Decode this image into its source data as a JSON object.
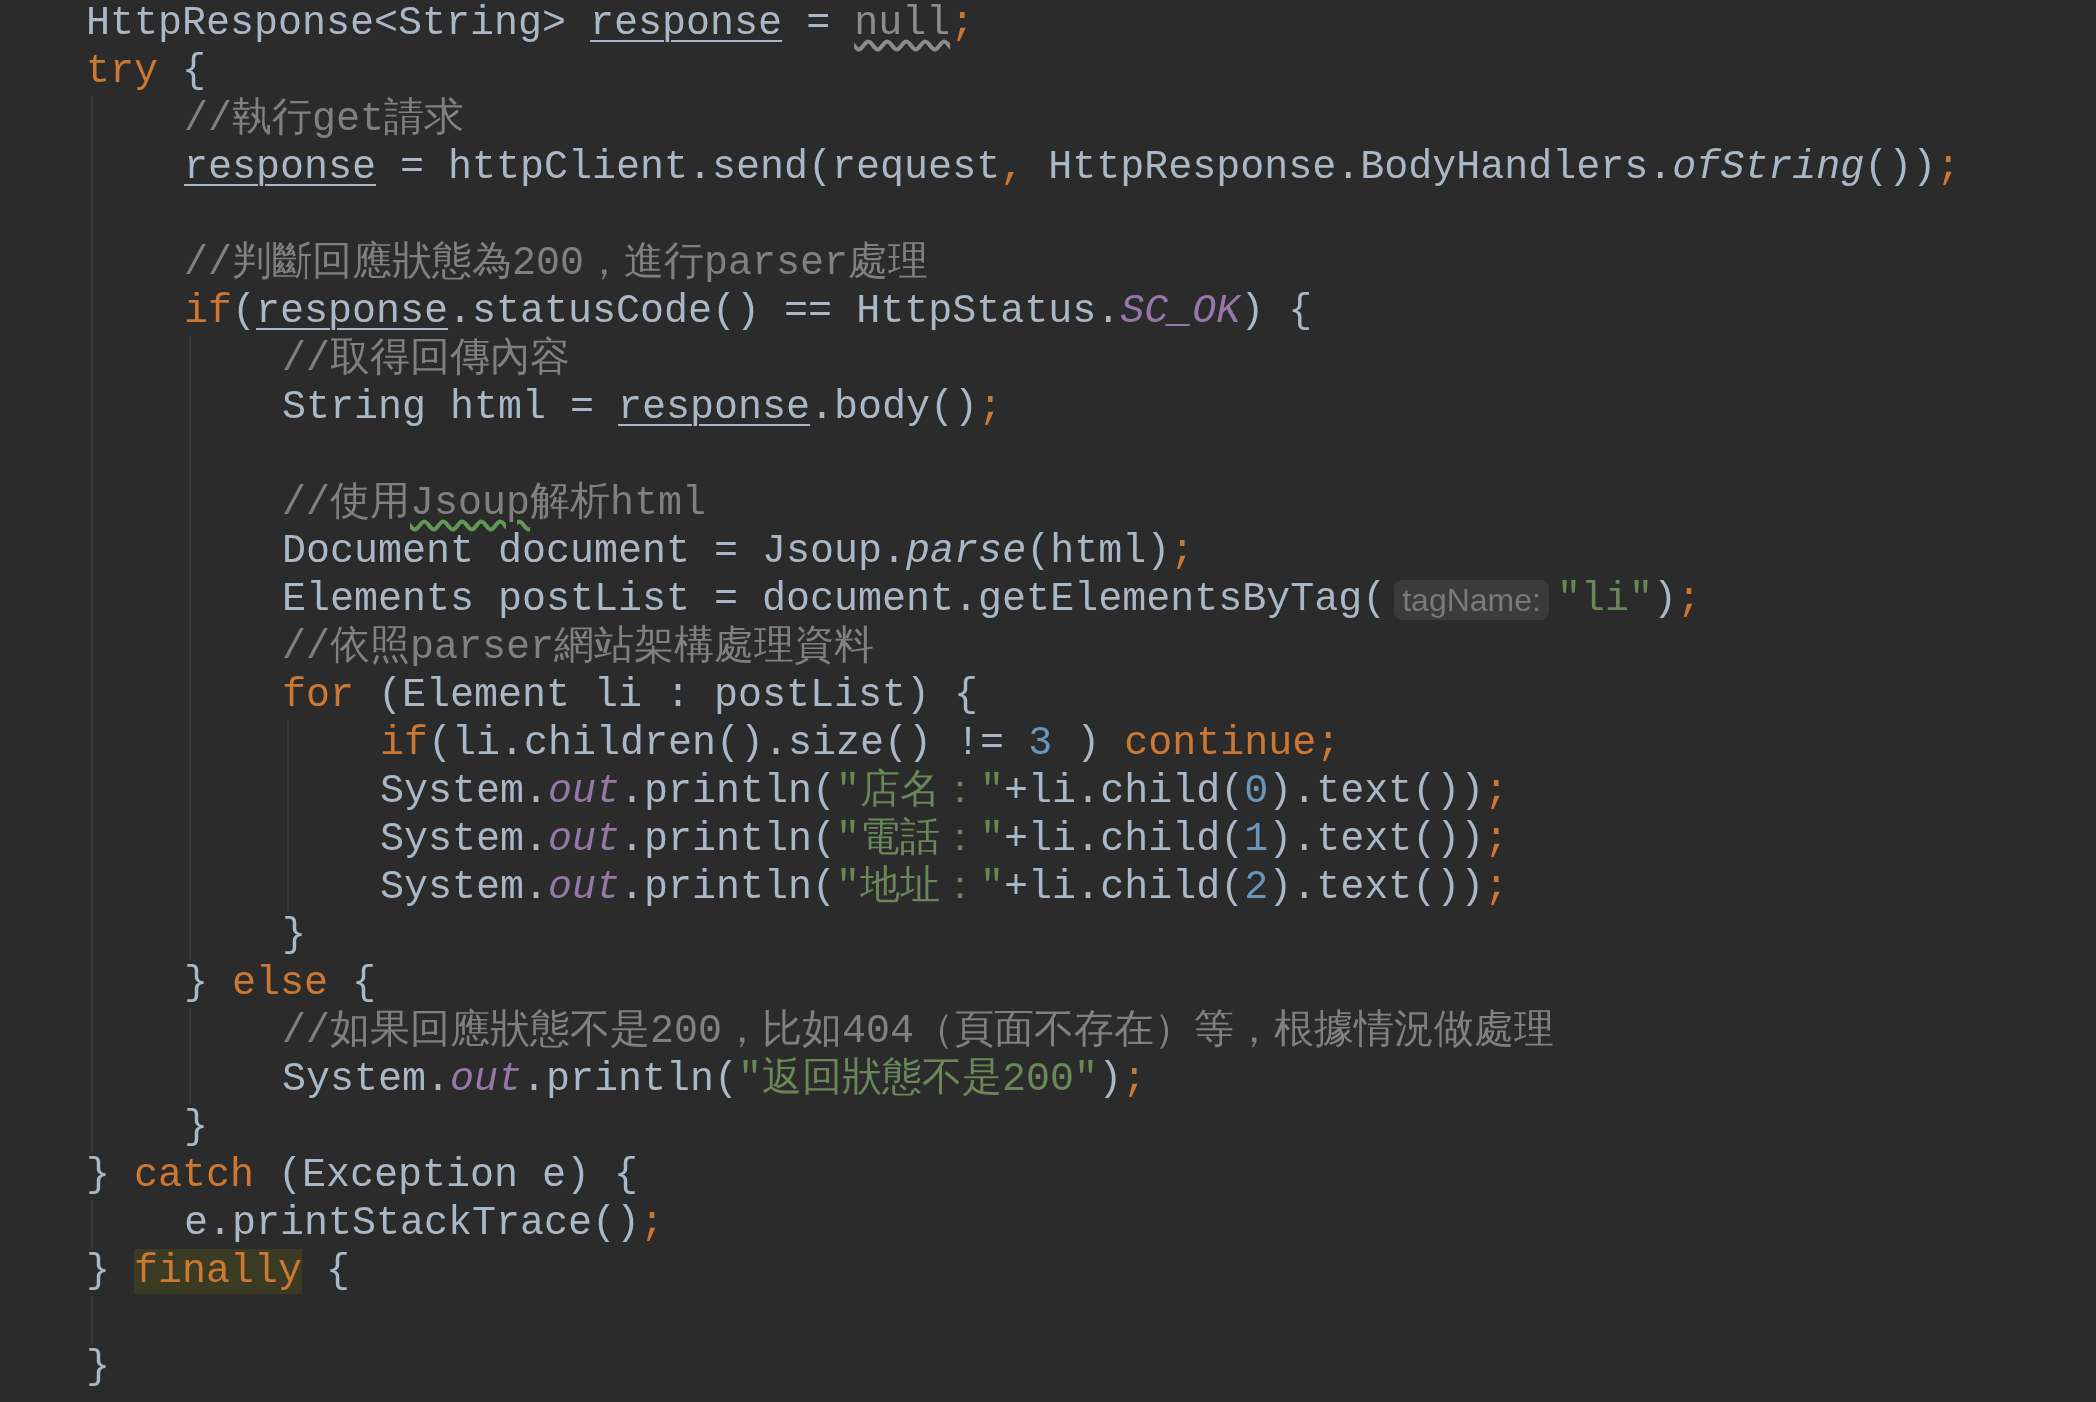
{
  "editor": {
    "lines": [
      {
        "kind": "code",
        "tokens": [
          {
            "kind": "plain",
            "text": "HttpResponse<String> "
          },
          {
            "kind": "var",
            "text": "response"
          },
          {
            "kind": "plain",
            "text": " = "
          },
          {
            "kind": "warning",
            "text": "null"
          },
          {
            "kind": "punct",
            "text": ";"
          }
        ]
      },
      {
        "kind": "code",
        "tokens": [
          {
            "kind": "keyword",
            "text": "try"
          },
          {
            "kind": "plain",
            "text": " {"
          }
        ],
        "children": [
          {
            "kind": "code",
            "tokens": [
              {
                "kind": "comment",
                "text": "//執行get請求"
              }
            ]
          },
          {
            "kind": "code",
            "tokens": [
              {
                "kind": "var",
                "text": "response"
              },
              {
                "kind": "plain",
                "text": " = httpClient.send(request"
              },
              {
                "kind": "punct",
                "text": ","
              },
              {
                "kind": "plain",
                "text": " HttpResponse.BodyHandlers."
              },
              {
                "kind": "italic",
                "text": "ofString"
              },
              {
                "kind": "plain",
                "text": "())"
              },
              {
                "kind": "punct",
                "text": ";"
              }
            ]
          },
          {
            "kind": "blank"
          },
          {
            "kind": "code",
            "tokens": [
              {
                "kind": "comment",
                "text": "//判斷回應狀態為200，進行parser處理"
              }
            ]
          },
          {
            "kind": "code",
            "tokens": [
              {
                "kind": "keyword",
                "text": "if"
              },
              {
                "kind": "plain",
                "text": "("
              },
              {
                "kind": "var",
                "text": "response"
              },
              {
                "kind": "plain",
                "text": ".statusCode() == HttpStatus."
              },
              {
                "kind": "field",
                "text": "SC_OK"
              },
              {
                "kind": "plain",
                "text": ") {"
              }
            ],
            "children": [
              {
                "kind": "code",
                "tokens": [
                  {
                    "kind": "comment",
                    "text": "//取得回傳內容"
                  }
                ]
              },
              {
                "kind": "code",
                "tokens": [
                  {
                    "kind": "plain",
                    "text": "String html = "
                  },
                  {
                    "kind": "var",
                    "text": "response"
                  },
                  {
                    "kind": "plain",
                    "text": ".body()"
                  },
                  {
                    "kind": "punct",
                    "text": ";"
                  }
                ]
              },
              {
                "kind": "blank"
              },
              {
                "kind": "code",
                "tokens": [
                  {
                    "kind": "comment",
                    "text": "//使用"
                  },
                  {
                    "kind": "typo",
                    "text": "Jsoup"
                  },
                  {
                    "kind": "comment",
                    "text": "解析html"
                  }
                ]
              },
              {
                "kind": "code",
                "tokens": [
                  {
                    "kind": "plain",
                    "text": "Document document = Jsoup."
                  },
                  {
                    "kind": "italic",
                    "text": "parse"
                  },
                  {
                    "kind": "plain",
                    "text": "(html)"
                  },
                  {
                    "kind": "punct",
                    "text": ";"
                  }
                ]
              },
              {
                "kind": "code",
                "tokens": [
                  {
                    "kind": "plain",
                    "text": "Elements postList = document.getElementsByTag("
                  },
                  {
                    "kind": "hint",
                    "text": "tagName:"
                  },
                  {
                    "kind": "string",
                    "text": "\"li\""
                  },
                  {
                    "kind": "plain",
                    "text": ")"
                  },
                  {
                    "kind": "punct",
                    "text": ";"
                  }
                ]
              },
              {
                "kind": "code",
                "tokens": [
                  {
                    "kind": "comment",
                    "text": "//依照parser網站架構處理資料"
                  }
                ]
              },
              {
                "kind": "code",
                "tokens": [
                  {
                    "kind": "keyword",
                    "text": "for"
                  },
                  {
                    "kind": "plain",
                    "text": " (Element li : postList) {"
                  }
                ],
                "children": [
                  {
                    "kind": "code",
                    "tokens": [
                      {
                        "kind": "keyword",
                        "text": "if"
                      },
                      {
                        "kind": "plain",
                        "text": "(li.children().size() != "
                      },
                      {
                        "kind": "number",
                        "text": "3"
                      },
                      {
                        "kind": "plain",
                        "text": " ) "
                      },
                      {
                        "kind": "keyword",
                        "text": "continue"
                      },
                      {
                        "kind": "punct",
                        "text": ";"
                      }
                    ]
                  },
                  {
                    "kind": "code",
                    "tokens": [
                      {
                        "kind": "plain",
                        "text": "System."
                      },
                      {
                        "kind": "field",
                        "text": "out"
                      },
                      {
                        "kind": "plain",
                        "text": ".println("
                      },
                      {
                        "kind": "string",
                        "text": "\"店名：\""
                      },
                      {
                        "kind": "plain",
                        "text": "+li.child("
                      },
                      {
                        "kind": "number",
                        "text": "0"
                      },
                      {
                        "kind": "plain",
                        "text": ").text())"
                      },
                      {
                        "kind": "punct",
                        "text": ";"
                      }
                    ]
                  },
                  {
                    "kind": "code",
                    "tokens": [
                      {
                        "kind": "plain",
                        "text": "System."
                      },
                      {
                        "kind": "field",
                        "text": "out"
                      },
                      {
                        "kind": "plain",
                        "text": ".println("
                      },
                      {
                        "kind": "string",
                        "text": "\"電話：\""
                      },
                      {
                        "kind": "plain",
                        "text": "+li.child("
                      },
                      {
                        "kind": "number",
                        "text": "1"
                      },
                      {
                        "kind": "plain",
                        "text": ").text())"
                      },
                      {
                        "kind": "punct",
                        "text": ";"
                      }
                    ]
                  },
                  {
                    "kind": "code",
                    "tokens": [
                      {
                        "kind": "plain",
                        "text": "System."
                      },
                      {
                        "kind": "field",
                        "text": "out"
                      },
                      {
                        "kind": "plain",
                        "text": ".println("
                      },
                      {
                        "kind": "string",
                        "text": "\"地址：\""
                      },
                      {
                        "kind": "plain",
                        "text": "+li.child("
                      },
                      {
                        "kind": "number",
                        "text": "2"
                      },
                      {
                        "kind": "plain",
                        "text": ").text())"
                      },
                      {
                        "kind": "punct",
                        "text": ";"
                      }
                    ]
                  }
                ]
              },
              {
                "kind": "code",
                "tokens": [
                  {
                    "kind": "plain",
                    "text": "}"
                  }
                ]
              }
            ]
          },
          {
            "kind": "code",
            "tokens": [
              {
                "kind": "plain",
                "text": "} "
              },
              {
                "kind": "keyword",
                "text": "else"
              },
              {
                "kind": "plain",
                "text": " {"
              }
            ],
            "children": [
              {
                "kind": "code",
                "tokens": [
                  {
                    "kind": "comment",
                    "text": "//如果回應狀態不是200，比如404（頁面不存在）等，根據情況做處理"
                  }
                ]
              },
              {
                "kind": "code",
                "tokens": [
                  {
                    "kind": "plain",
                    "text": "System."
                  },
                  {
                    "kind": "field",
                    "text": "out"
                  },
                  {
                    "kind": "plain",
                    "text": ".println("
                  },
                  {
                    "kind": "string",
                    "text": "\"返回狀態不是200\""
                  },
                  {
                    "kind": "plain",
                    "text": ")"
                  },
                  {
                    "kind": "punct",
                    "text": ";"
                  }
                ]
              }
            ]
          },
          {
            "kind": "code",
            "tokens": [
              {
                "kind": "plain",
                "text": "}"
              }
            ]
          }
        ]
      },
      {
        "kind": "code",
        "tokens": [
          {
            "kind": "plain",
            "text": "} "
          },
          {
            "kind": "keyword",
            "text": "catch"
          },
          {
            "kind": "plain",
            "text": " (Exception e) {"
          }
        ],
        "children": [
          {
            "kind": "code",
            "tokens": [
              {
                "kind": "plain",
                "text": "e.printStackTrace()"
              },
              {
                "kind": "punct",
                "text": ";"
              }
            ]
          }
        ]
      },
      {
        "kind": "code",
        "tokens": [
          {
            "kind": "plain",
            "text": "} "
          },
          {
            "kind": "highlight",
            "text": "finally"
          },
          {
            "kind": "plain",
            "text": " {"
          }
        ],
        "children": [
          {
            "kind": "blank"
          }
        ]
      },
      {
        "kind": "code",
        "tokens": [
          {
            "kind": "plain",
            "text": "}"
          }
        ]
      }
    ]
  }
}
